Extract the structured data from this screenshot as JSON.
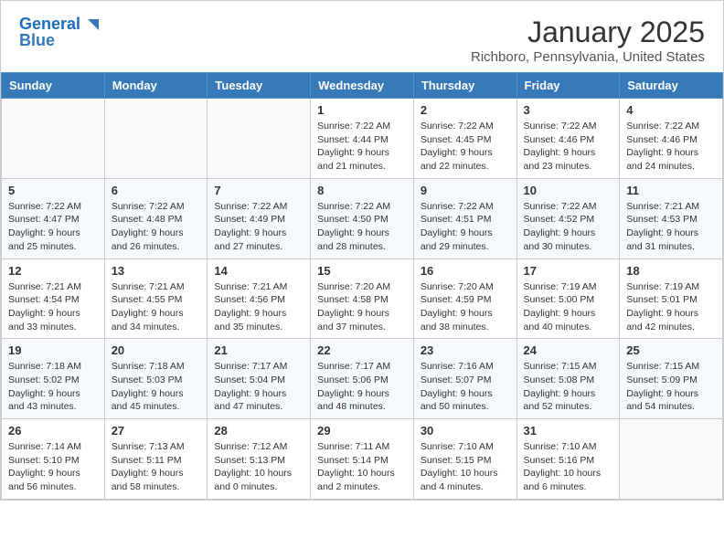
{
  "header": {
    "logo_line1": "General",
    "logo_line2": "Blue",
    "month_title": "January 2025",
    "location": "Richboro, Pennsylvania, United States"
  },
  "weekdays": [
    "Sunday",
    "Monday",
    "Tuesday",
    "Wednesday",
    "Thursday",
    "Friday",
    "Saturday"
  ],
  "weeks": [
    [
      {
        "day": "",
        "info": ""
      },
      {
        "day": "",
        "info": ""
      },
      {
        "day": "",
        "info": ""
      },
      {
        "day": "1",
        "info": "Sunrise: 7:22 AM\nSunset: 4:44 PM\nDaylight: 9 hours\nand 21 minutes."
      },
      {
        "day": "2",
        "info": "Sunrise: 7:22 AM\nSunset: 4:45 PM\nDaylight: 9 hours\nand 22 minutes."
      },
      {
        "day": "3",
        "info": "Sunrise: 7:22 AM\nSunset: 4:46 PM\nDaylight: 9 hours\nand 23 minutes."
      },
      {
        "day": "4",
        "info": "Sunrise: 7:22 AM\nSunset: 4:46 PM\nDaylight: 9 hours\nand 24 minutes."
      }
    ],
    [
      {
        "day": "5",
        "info": "Sunrise: 7:22 AM\nSunset: 4:47 PM\nDaylight: 9 hours\nand 25 minutes."
      },
      {
        "day": "6",
        "info": "Sunrise: 7:22 AM\nSunset: 4:48 PM\nDaylight: 9 hours\nand 26 minutes."
      },
      {
        "day": "7",
        "info": "Sunrise: 7:22 AM\nSunset: 4:49 PM\nDaylight: 9 hours\nand 27 minutes."
      },
      {
        "day": "8",
        "info": "Sunrise: 7:22 AM\nSunset: 4:50 PM\nDaylight: 9 hours\nand 28 minutes."
      },
      {
        "day": "9",
        "info": "Sunrise: 7:22 AM\nSunset: 4:51 PM\nDaylight: 9 hours\nand 29 minutes."
      },
      {
        "day": "10",
        "info": "Sunrise: 7:22 AM\nSunset: 4:52 PM\nDaylight: 9 hours\nand 30 minutes."
      },
      {
        "day": "11",
        "info": "Sunrise: 7:21 AM\nSunset: 4:53 PM\nDaylight: 9 hours\nand 31 minutes."
      }
    ],
    [
      {
        "day": "12",
        "info": "Sunrise: 7:21 AM\nSunset: 4:54 PM\nDaylight: 9 hours\nand 33 minutes."
      },
      {
        "day": "13",
        "info": "Sunrise: 7:21 AM\nSunset: 4:55 PM\nDaylight: 9 hours\nand 34 minutes."
      },
      {
        "day": "14",
        "info": "Sunrise: 7:21 AM\nSunset: 4:56 PM\nDaylight: 9 hours\nand 35 minutes."
      },
      {
        "day": "15",
        "info": "Sunrise: 7:20 AM\nSunset: 4:58 PM\nDaylight: 9 hours\nand 37 minutes."
      },
      {
        "day": "16",
        "info": "Sunrise: 7:20 AM\nSunset: 4:59 PM\nDaylight: 9 hours\nand 38 minutes."
      },
      {
        "day": "17",
        "info": "Sunrise: 7:19 AM\nSunset: 5:00 PM\nDaylight: 9 hours\nand 40 minutes."
      },
      {
        "day": "18",
        "info": "Sunrise: 7:19 AM\nSunset: 5:01 PM\nDaylight: 9 hours\nand 42 minutes."
      }
    ],
    [
      {
        "day": "19",
        "info": "Sunrise: 7:18 AM\nSunset: 5:02 PM\nDaylight: 9 hours\nand 43 minutes."
      },
      {
        "day": "20",
        "info": "Sunrise: 7:18 AM\nSunset: 5:03 PM\nDaylight: 9 hours\nand 45 minutes."
      },
      {
        "day": "21",
        "info": "Sunrise: 7:17 AM\nSunset: 5:04 PM\nDaylight: 9 hours\nand 47 minutes."
      },
      {
        "day": "22",
        "info": "Sunrise: 7:17 AM\nSunset: 5:06 PM\nDaylight: 9 hours\nand 48 minutes."
      },
      {
        "day": "23",
        "info": "Sunrise: 7:16 AM\nSunset: 5:07 PM\nDaylight: 9 hours\nand 50 minutes."
      },
      {
        "day": "24",
        "info": "Sunrise: 7:15 AM\nSunset: 5:08 PM\nDaylight: 9 hours\nand 52 minutes."
      },
      {
        "day": "25",
        "info": "Sunrise: 7:15 AM\nSunset: 5:09 PM\nDaylight: 9 hours\nand 54 minutes."
      }
    ],
    [
      {
        "day": "26",
        "info": "Sunrise: 7:14 AM\nSunset: 5:10 PM\nDaylight: 9 hours\nand 56 minutes."
      },
      {
        "day": "27",
        "info": "Sunrise: 7:13 AM\nSunset: 5:11 PM\nDaylight: 9 hours\nand 58 minutes."
      },
      {
        "day": "28",
        "info": "Sunrise: 7:12 AM\nSunset: 5:13 PM\nDaylight: 10 hours\nand 0 minutes."
      },
      {
        "day": "29",
        "info": "Sunrise: 7:11 AM\nSunset: 5:14 PM\nDaylight: 10 hours\nand 2 minutes."
      },
      {
        "day": "30",
        "info": "Sunrise: 7:10 AM\nSunset: 5:15 PM\nDaylight: 10 hours\nand 4 minutes."
      },
      {
        "day": "31",
        "info": "Sunrise: 7:10 AM\nSunset: 5:16 PM\nDaylight: 10 hours\nand 6 minutes."
      },
      {
        "day": "",
        "info": ""
      }
    ]
  ]
}
